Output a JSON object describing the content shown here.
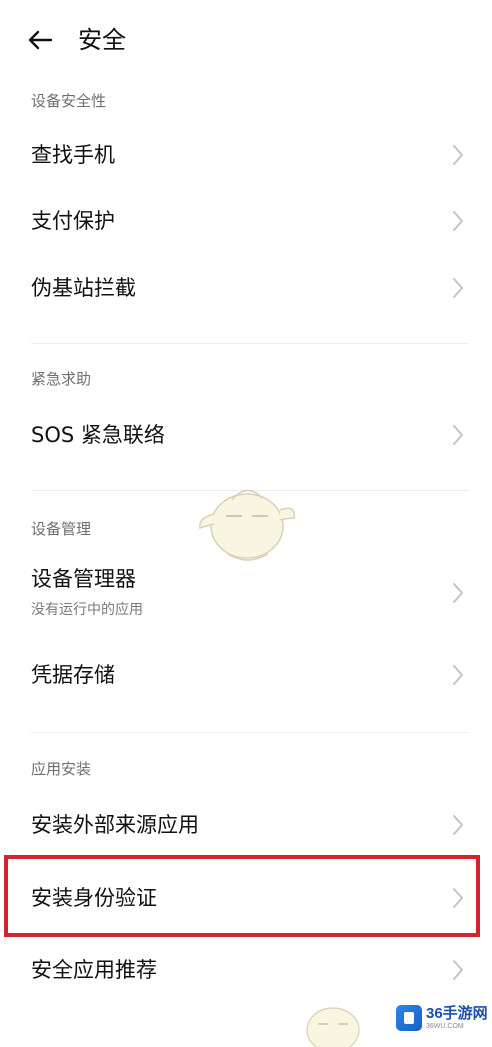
{
  "header": {
    "title": "安全"
  },
  "sections": [
    {
      "label": "设备安全性",
      "items": [
        {
          "title": "查找手机"
        },
        {
          "title": "支付保护"
        },
        {
          "title": "伪基站拦截"
        }
      ]
    },
    {
      "label": "紧急求助",
      "items": [
        {
          "title": "SOS 紧急联络"
        }
      ]
    },
    {
      "label": "设备管理",
      "items": [
        {
          "title": "设备管理器",
          "subtitle": "没有运行中的应用"
        },
        {
          "title": "凭据存储"
        }
      ]
    },
    {
      "label": "应用安装",
      "items": [
        {
          "title": "安装外部来源应用"
        },
        {
          "title": "安装身份验证"
        },
        {
          "title": "安全应用推荐"
        }
      ]
    }
  ],
  "highlight_color": "#d2232f",
  "logo": {
    "name": "36手游网",
    "domain": "36WU.COM"
  },
  "icons": {
    "back": "arrow-left-icon",
    "chevron": "chevron-right-icon"
  }
}
